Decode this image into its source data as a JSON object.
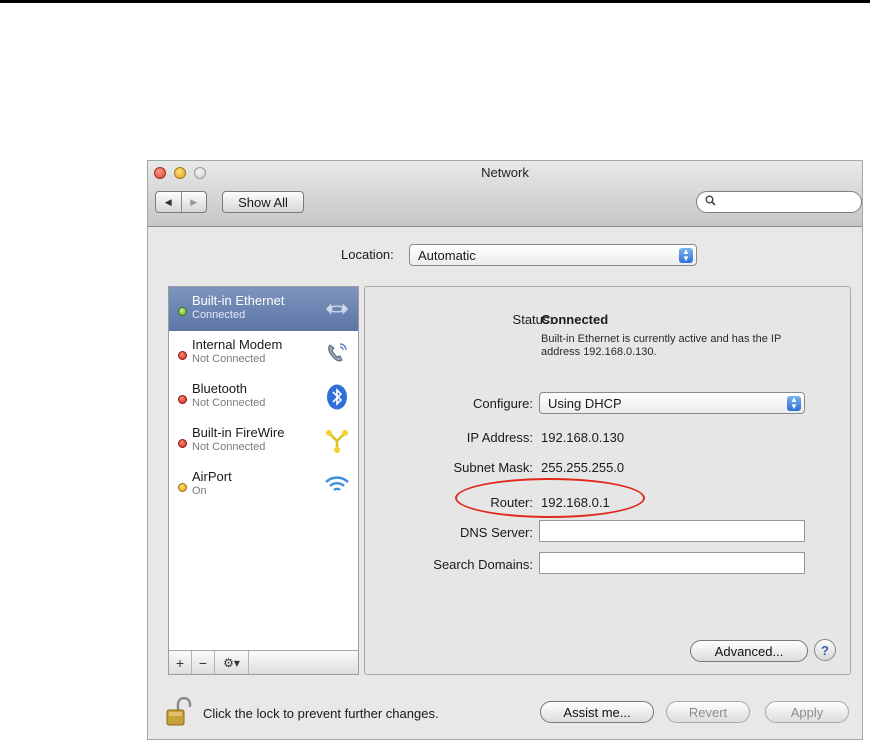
{
  "window": {
    "title": "Network"
  },
  "toolbar": {
    "back_glyph": "◀",
    "forward_glyph": "▶",
    "show_all": "Show All",
    "search_glyph": "⚲",
    "search_value": ""
  },
  "location": {
    "label": "Location:",
    "value": "Automatic"
  },
  "services": [
    {
      "name": "Built-in Ethernet",
      "status": "Connected",
      "dot": "green",
      "icon": "ethernet-icon",
      "selected": true
    },
    {
      "name": "Internal Modem",
      "status": "Not Connected",
      "dot": "red",
      "icon": "phone-icon",
      "selected": false
    },
    {
      "name": "Bluetooth",
      "status": "Not Connected",
      "dot": "red",
      "icon": "bluetooth-icon",
      "selected": false
    },
    {
      "name": "Built-in FireWire",
      "status": "Not Connected",
      "dot": "red",
      "icon": "firewire-icon",
      "selected": false
    },
    {
      "name": "AirPort",
      "status": "On",
      "dot": "yellow",
      "icon": "wifi-icon",
      "selected": false
    }
  ],
  "sidebar_tools": {
    "add": "+",
    "remove": "−",
    "action": "⚙▾"
  },
  "detail": {
    "status_label": "Status:",
    "status_value": "Connected",
    "status_description": "Built-in Ethernet is currently active and has the IP address 192.168.0.130.",
    "configure_label": "Configure:",
    "configure_value": "Using DHCP",
    "ip_label": "IP Address:",
    "ip_value": "192.168.0.130",
    "mask_label": "Subnet Mask:",
    "mask_value": "255.255.255.0",
    "router_label": "Router:",
    "router_value": "192.168.0.1",
    "dns_label": "DNS Server:",
    "dns_value": "",
    "search_domains_label": "Search Domains:",
    "search_domains_value": "",
    "advanced": "Advanced...",
    "help": "?"
  },
  "footer": {
    "lock_text": "Click the lock to prevent further changes.",
    "assist": "Assist me...",
    "revert": "Revert",
    "apply": "Apply"
  },
  "colors": {
    "selection": "#6a83b3",
    "highlight_ring": "#e0281b",
    "help_accent": "#3d5bb8"
  }
}
